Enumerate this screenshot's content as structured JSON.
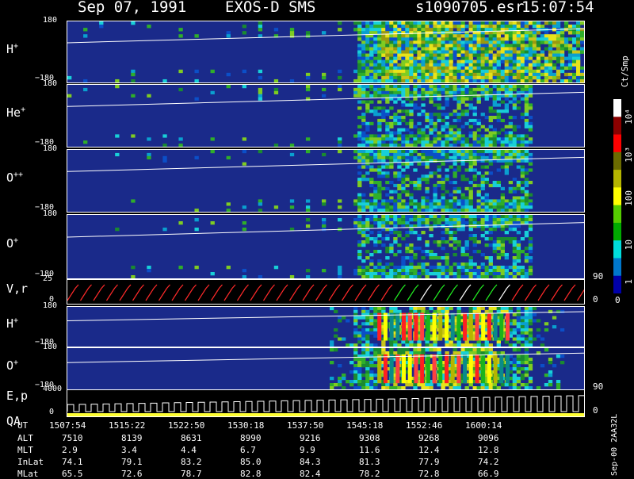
{
  "header": {
    "date": "Sep 07, 1991",
    "instrument": "EXOS-D SMS",
    "file": "s1090705.esr",
    "time": "15:07:54"
  },
  "colorbar": {
    "unit": "Ct/Smp",
    "ticks": [
      "10⁴",
      "10³",
      "100",
      "10",
      "1",
      "0"
    ],
    "colors": [
      "#ffffff",
      "#8b0000",
      "#ff0000",
      "#6b6b00",
      "#b5b500",
      "#ffff00",
      "#55cc00",
      "#00aa00",
      "#00dddd",
      "#0077cc",
      "#0000aa"
    ]
  },
  "panels": [
    {
      "id": "H+",
      "label": "H",
      "sup": "+",
      "top": "180",
      "bottom": "−180"
    },
    {
      "id": "He+",
      "label": "He",
      "sup": "+",
      "top": "180",
      "bottom": "−180"
    },
    {
      "id": "O++",
      "label": "O",
      "sup": "++",
      "top": "180",
      "bottom": "−180"
    },
    {
      "id": "O+",
      "label": "O",
      "sup": "+",
      "top": "180",
      "bottom": "−180"
    },
    {
      "id": "Vr",
      "label": "V,r",
      "sup": "",
      "top": "25",
      "bottom": "0"
    },
    {
      "id": "H+2",
      "label": "H",
      "sup": "+",
      "top": "180",
      "bottom": "−180"
    },
    {
      "id": "O+2",
      "label": "O",
      "sup": "+",
      "top": "180",
      "bottom": "−180"
    },
    {
      "id": "Ep",
      "label": "E,p",
      "label2": "QA",
      "top": "4000",
      "bottom": "0"
    }
  ],
  "right_ticks": {
    "vr_top": "90",
    "vr_bottom": "0",
    "o2_top": "90",
    "ep_bottom": "0"
  },
  "side_label": "Sep-00  2AA32L",
  "ephemeris": {
    "rows": [
      "UT",
      "ALT",
      "MLT",
      "InLat",
      "MLat"
    ],
    "columns": [
      {
        "UT": "1507:54",
        "ALT": "7510",
        "MLT": "2.9",
        "InLat": "74.1",
        "MLat": "65.5"
      },
      {
        "UT": "1515:22",
        "ALT": "8139",
        "MLT": "3.4",
        "InLat": "79.1",
        "MLat": "72.6"
      },
      {
        "UT": "1522:50",
        "ALT": "8631",
        "MLT": "4.4",
        "InLat": "83.2",
        "MLat": "78.7"
      },
      {
        "UT": "1530:18",
        "ALT": "8990",
        "MLT": "6.7",
        "InLat": "85.0",
        "MLat": "82.8"
      },
      {
        "UT": "1537:50",
        "ALT": "9216",
        "MLT": "9.9",
        "InLat": "84.3",
        "MLat": "82.4"
      },
      {
        "UT": "1545:18",
        "ALT": "9308",
        "MLT": "11.6",
        "InLat": "81.3",
        "MLat": "78.2"
      },
      {
        "UT": "1552:46",
        "ALT": "9268",
        "MLT": "12.4",
        "InLat": "77.9",
        "MLat": "72.8"
      },
      {
        "UT": "1600:14",
        "ALT": "9096",
        "MLT": "12.8",
        "InLat": "74.2",
        "MLat": "66.9"
      }
    ]
  },
  "chart_data": {
    "type": "heatmap",
    "x_axis": "UT",
    "x_ticks": [
      "1507:54",
      "1515:22",
      "1522:50",
      "1530:18",
      "1537:50",
      "1545:18",
      "1552:46",
      "1600:14"
    ],
    "y_range_pitch_angle": [
      -180,
      180
    ],
    "colorbar_range": [
      0,
      10000
    ],
    "colorbar_label": "Ct/Smp",
    "panels": [
      "H+",
      "He+",
      "O++",
      "O+",
      "V,r",
      "H+",
      "O+",
      "E,p / QA"
    ]
  }
}
